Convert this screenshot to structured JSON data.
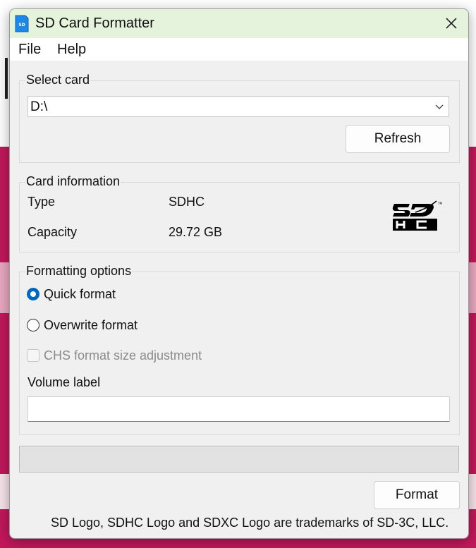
{
  "window": {
    "title": "SD Card Formatter"
  },
  "menu": {
    "file": "File",
    "help": "Help"
  },
  "select_card": {
    "group_title": "Select card",
    "selected_drive": "D:\\",
    "refresh_label": "Refresh"
  },
  "card_info": {
    "group_title": "Card information",
    "type_label": "Type",
    "type_value": "SDHC",
    "capacity_label": "Capacity",
    "capacity_value": "29.72 GB",
    "logo_text": "SDHC"
  },
  "formatting": {
    "group_title": "Formatting options",
    "quick_format": "Quick format",
    "overwrite_format": "Overwrite format",
    "chs_adjustment": "CHS format size adjustment",
    "volume_label_title": "Volume label",
    "volume_label_value": "",
    "selected_option": "quick_format"
  },
  "progress": {
    "value": 0
  },
  "actions": {
    "format_label": "Format"
  },
  "footer": {
    "trademark_text": "SD Logo, SDHC Logo and SDXC Logo are trademarks of SD-3C, LLC."
  },
  "colors": {
    "accent": "#0067c0",
    "titlebar": "#e6f3dc",
    "background_app": "#c2185b"
  }
}
